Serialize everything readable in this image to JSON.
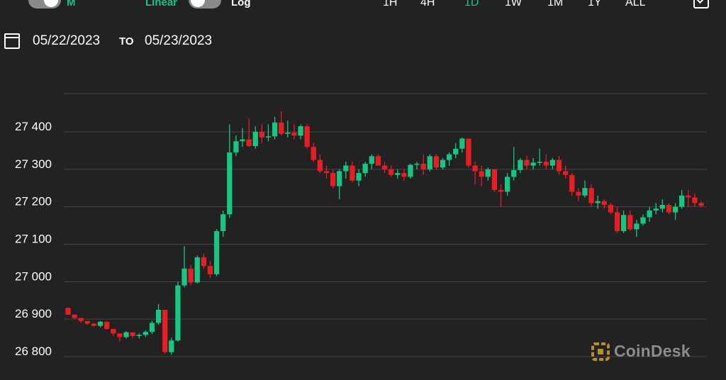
{
  "toolbar": {
    "toggle1_label": "M",
    "linear_label": "Linear",
    "log_label": "Log",
    "ranges": [
      {
        "label": "1H",
        "active": false
      },
      {
        "label": "4H",
        "active": false
      },
      {
        "label": "1D",
        "active": true
      },
      {
        "label": "1W",
        "active": false
      },
      {
        "label": "1M",
        "active": false
      },
      {
        "label": "1Y",
        "active": false
      },
      {
        "label": "ALL",
        "active": false
      }
    ]
  },
  "date_range": {
    "from": "05/22/2023",
    "to_label": "TO",
    "to": "05/23/2023"
  },
  "brand": {
    "name": "CoinDesk"
  },
  "colors": {
    "up": "#16c784",
    "down": "#ea1c24",
    "background": "#222222",
    "grid": "#444444"
  },
  "chart_data": {
    "type": "candlestick",
    "title": "",
    "ylim": [
      26780,
      27500
    ],
    "yticks": [
      26800,
      26900,
      27000,
      27100,
      27200,
      27300,
      27400
    ],
    "ytick_labels": [
      "26 800",
      "26 900",
      "27 000",
      "27 100",
      "27 200",
      "27 300",
      "27 400"
    ],
    "grid": true,
    "series": [
      {
        "candles": [
          [
            26930,
            26930,
            26912,
            26912
          ],
          [
            26912,
            26912,
            26900,
            26903
          ],
          [
            26903,
            26903,
            26890,
            26895
          ],
          [
            26895,
            26895,
            26885,
            26888
          ],
          [
            26888,
            26890,
            26880,
            26882
          ],
          [
            26882,
            26895,
            26878,
            26893
          ],
          [
            26893,
            26893,
            26872,
            26874
          ],
          [
            26874,
            26874,
            26855,
            26862
          ],
          [
            26862,
            26862,
            26840,
            26852
          ],
          [
            26852,
            26868,
            26848,
            26865
          ],
          [
            26865,
            26865,
            26850,
            26855
          ],
          [
            26855,
            26862,
            26848,
            26858
          ],
          [
            26858,
            26870,
            26852,
            26866
          ],
          [
            26866,
            26895,
            26860,
            26890
          ],
          [
            26890,
            26940,
            26885,
            26925
          ],
          [
            26925,
            26925,
            26808,
            26812
          ],
          [
            26812,
            26850,
            26805,
            26843
          ],
          [
            26843,
            27000,
            26840,
            26990
          ],
          [
            26990,
            27095,
            26985,
            27035
          ],
          [
            27035,
            27045,
            26990,
            26998
          ],
          [
            26998,
            27070,
            26995,
            27065
          ],
          [
            27065,
            27075,
            27035,
            27042
          ],
          [
            27042,
            27055,
            27010,
            27020
          ],
          [
            27020,
            27140,
            27015,
            27135
          ],
          [
            27135,
            27190,
            27120,
            27180
          ],
          [
            27180,
            27420,
            27170,
            27345
          ],
          [
            27345,
            27390,
            27335,
            27375
          ],
          [
            27375,
            27410,
            27360,
            27380
          ],
          [
            27380,
            27435,
            27360,
            27362
          ],
          [
            27362,
            27415,
            27355,
            27400
          ],
          [
            27400,
            27420,
            27370,
            27385
          ],
          [
            27385,
            27420,
            27375,
            27388
          ],
          [
            27388,
            27440,
            27380,
            27425
          ],
          [
            27425,
            27455,
            27390,
            27395
          ],
          [
            27395,
            27430,
            27385,
            27398
          ],
          [
            27398,
            27420,
            27380,
            27390
          ],
          [
            27390,
            27420,
            27380,
            27415
          ],
          [
            27415,
            27420,
            27355,
            27360
          ],
          [
            27360,
            27370,
            27320,
            27325
          ],
          [
            27325,
            27340,
            27290,
            27295
          ],
          [
            27295,
            27310,
            27275,
            27290
          ],
          [
            27290,
            27300,
            27250,
            27255
          ],
          [
            27255,
            27300,
            27220,
            27295
          ],
          [
            27295,
            27320,
            27275,
            27310
          ],
          [
            27310,
            27320,
            27265,
            27270
          ],
          [
            27270,
            27300,
            27255,
            27290
          ],
          [
            27290,
            27320,
            27280,
            27315
          ],
          [
            27315,
            27340,
            27300,
            27335
          ],
          [
            27335,
            27340,
            27310,
            27310
          ],
          [
            27310,
            27320,
            27290,
            27300
          ],
          [
            27300,
            27310,
            27280,
            27285
          ],
          [
            27285,
            27300,
            27275,
            27290
          ],
          [
            27290,
            27300,
            27270,
            27280
          ],
          [
            27280,
            27315,
            27275,
            27312
          ],
          [
            27312,
            27320,
            27300,
            27315
          ],
          [
            27315,
            27340,
            27285,
            27300
          ],
          [
            27300,
            27340,
            27295,
            27335
          ],
          [
            27335,
            27340,
            27300,
            27305
          ],
          [
            27305,
            27330,
            27300,
            27325
          ],
          [
            27325,
            27345,
            27310,
            27340
          ],
          [
            27340,
            27370,
            27330,
            27355
          ],
          [
            27355,
            27385,
            27345,
            27382
          ],
          [
            27382,
            27382,
            27305,
            27310
          ],
          [
            27310,
            27320,
            27260,
            27295
          ],
          [
            27295,
            27310,
            27255,
            27280
          ],
          [
            27280,
            27305,
            27270,
            27300
          ],
          [
            27300,
            27300,
            27240,
            27245
          ],
          [
            27245,
            27260,
            27200,
            27240
          ],
          [
            27240,
            27290,
            27230,
            27280
          ],
          [
            27280,
            27360,
            27270,
            27298
          ],
          [
            27298,
            27330,
            27290,
            27325
          ],
          [
            27325,
            27335,
            27300,
            27310
          ],
          [
            27310,
            27330,
            27300,
            27318
          ],
          [
            27318,
            27355,
            27310,
            27320
          ],
          [
            27320,
            27340,
            27300,
            27310
          ],
          [
            27310,
            27330,
            27300,
            27325
          ],
          [
            27325,
            27335,
            27285,
            27295
          ],
          [
            27295,
            27310,
            27275,
            27285
          ],
          [
            27285,
            27290,
            27230,
            27240
          ],
          [
            27240,
            27250,
            27215,
            27230
          ],
          [
            27230,
            27270,
            27225,
            27250
          ],
          [
            27250,
            27260,
            27200,
            27210
          ],
          [
            27210,
            27230,
            27195,
            27215
          ],
          [
            27215,
            27220,
            27195,
            27205
          ],
          [
            27205,
            27210,
            27180,
            27185
          ],
          [
            27185,
            27200,
            27130,
            27135
          ],
          [
            27135,
            27190,
            27130,
            27178
          ],
          [
            27178,
            27190,
            27135,
            27140
          ],
          [
            27140,
            27165,
            27120,
            27155
          ],
          [
            27155,
            27180,
            27150,
            27172
          ],
          [
            27172,
            27200,
            27160,
            27190
          ],
          [
            27190,
            27210,
            27180,
            27195
          ],
          [
            27195,
            27220,
            27185,
            27205
          ],
          [
            27205,
            27210,
            27180,
            27185
          ],
          [
            27185,
            27210,
            27165,
            27200
          ],
          [
            27200,
            27245,
            27195,
            27230
          ],
          [
            27230,
            27245,
            27200,
            27225
          ],
          [
            27225,
            27235,
            27200,
            27210
          ],
          [
            27210,
            27215,
            27198,
            27203
          ]
        ]
      }
    ]
  }
}
